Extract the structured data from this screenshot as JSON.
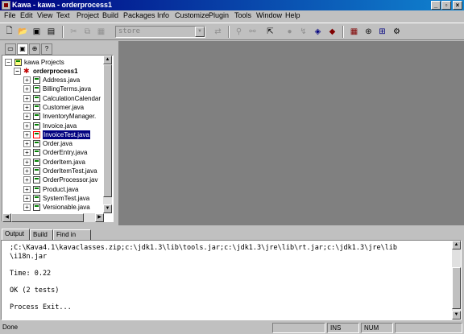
{
  "window": {
    "title": "Kawa - kawa - orderprocess1"
  },
  "menu": [
    "File",
    "Edit",
    "View",
    "Text",
    "Project",
    "Build",
    "Packages",
    "Info",
    "Customize",
    "Plugin",
    "Tools",
    "Window",
    "Help"
  ],
  "toolbar": {
    "combo_value": "store"
  },
  "tree": {
    "root": "kawa Projects",
    "project": "orderprocess1",
    "files": [
      "Address.java",
      "BillingTerms.java",
      "CalculationCalendar",
      "Customer.java",
      "InventoryManager.",
      "Invoice.java",
      "InvoiceTest.java",
      "Order.java",
      "OrderEntry.java",
      "OrderItem.java",
      "OrderItemTest.java",
      "OrderProcessor.jav",
      "Product.java",
      "SystemTest.java",
      "Versionable.java"
    ],
    "selected_index": 6
  },
  "output": {
    "tabs": [
      "Output",
      "Build",
      "Find in Files"
    ],
    "lines": [
      ";C:\\Kava4.1\\kavaclasses.zip;c:\\jdk1.3\\lib\\tools.jar;c:\\jdk1.3\\jre\\lib\\rt.jar;c:\\jdk1.3\\jre\\lib",
      "\\i18n.jar",
      "",
      "Time: 0.22",
      "",
      "OK (2 tests)",
      "",
      "Process Exit..."
    ]
  },
  "status": {
    "message": "Done",
    "ins": "INS",
    "num": "NUM"
  },
  "colors": {
    "title_start": "#000080",
    "title_end": "#1084d0",
    "mdi_background": "#808080",
    "selection": "#000080"
  }
}
